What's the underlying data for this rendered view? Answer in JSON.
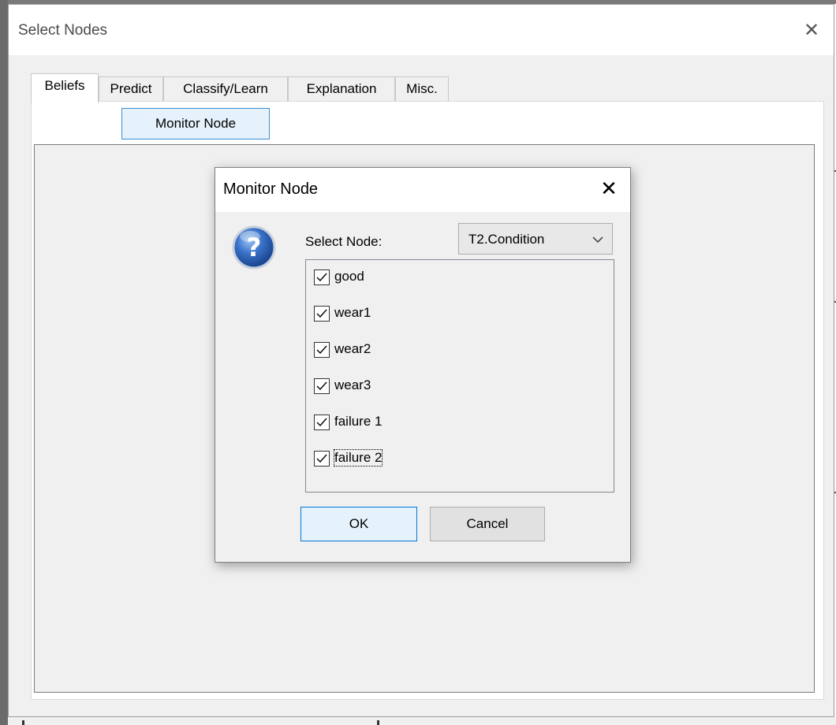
{
  "window": {
    "title": "Select Nodes",
    "close_glyph": "✕"
  },
  "tabs": [
    {
      "label": "Beliefs",
      "active": true
    },
    {
      "label": "Predict",
      "active": false
    },
    {
      "label": "Classify/Learn",
      "active": false
    },
    {
      "label": "Explanation",
      "active": false
    },
    {
      "label": "Misc.",
      "active": false
    }
  ],
  "subtab": {
    "label": "Monitor Node"
  },
  "dialog": {
    "title": "Monitor Node",
    "close_glyph": "✕",
    "icon": "question-icon",
    "select_label": "Select Node:",
    "select_value": "T2.Condition",
    "items": [
      {
        "label": "good",
        "checked": true
      },
      {
        "label": "wear1",
        "checked": true
      },
      {
        "label": "wear2",
        "checked": true
      },
      {
        "label": "wear3",
        "checked": true
      },
      {
        "label": "failure 1",
        "checked": true
      },
      {
        "label": "failure 2",
        "checked": true,
        "focused": true
      }
    ],
    "ok_label": "OK",
    "cancel_label": "Cancel"
  },
  "colors": {
    "accent": "#0078d7",
    "button_highlight": "#e5f1fb",
    "icon_blue": "#1e4fa3"
  }
}
